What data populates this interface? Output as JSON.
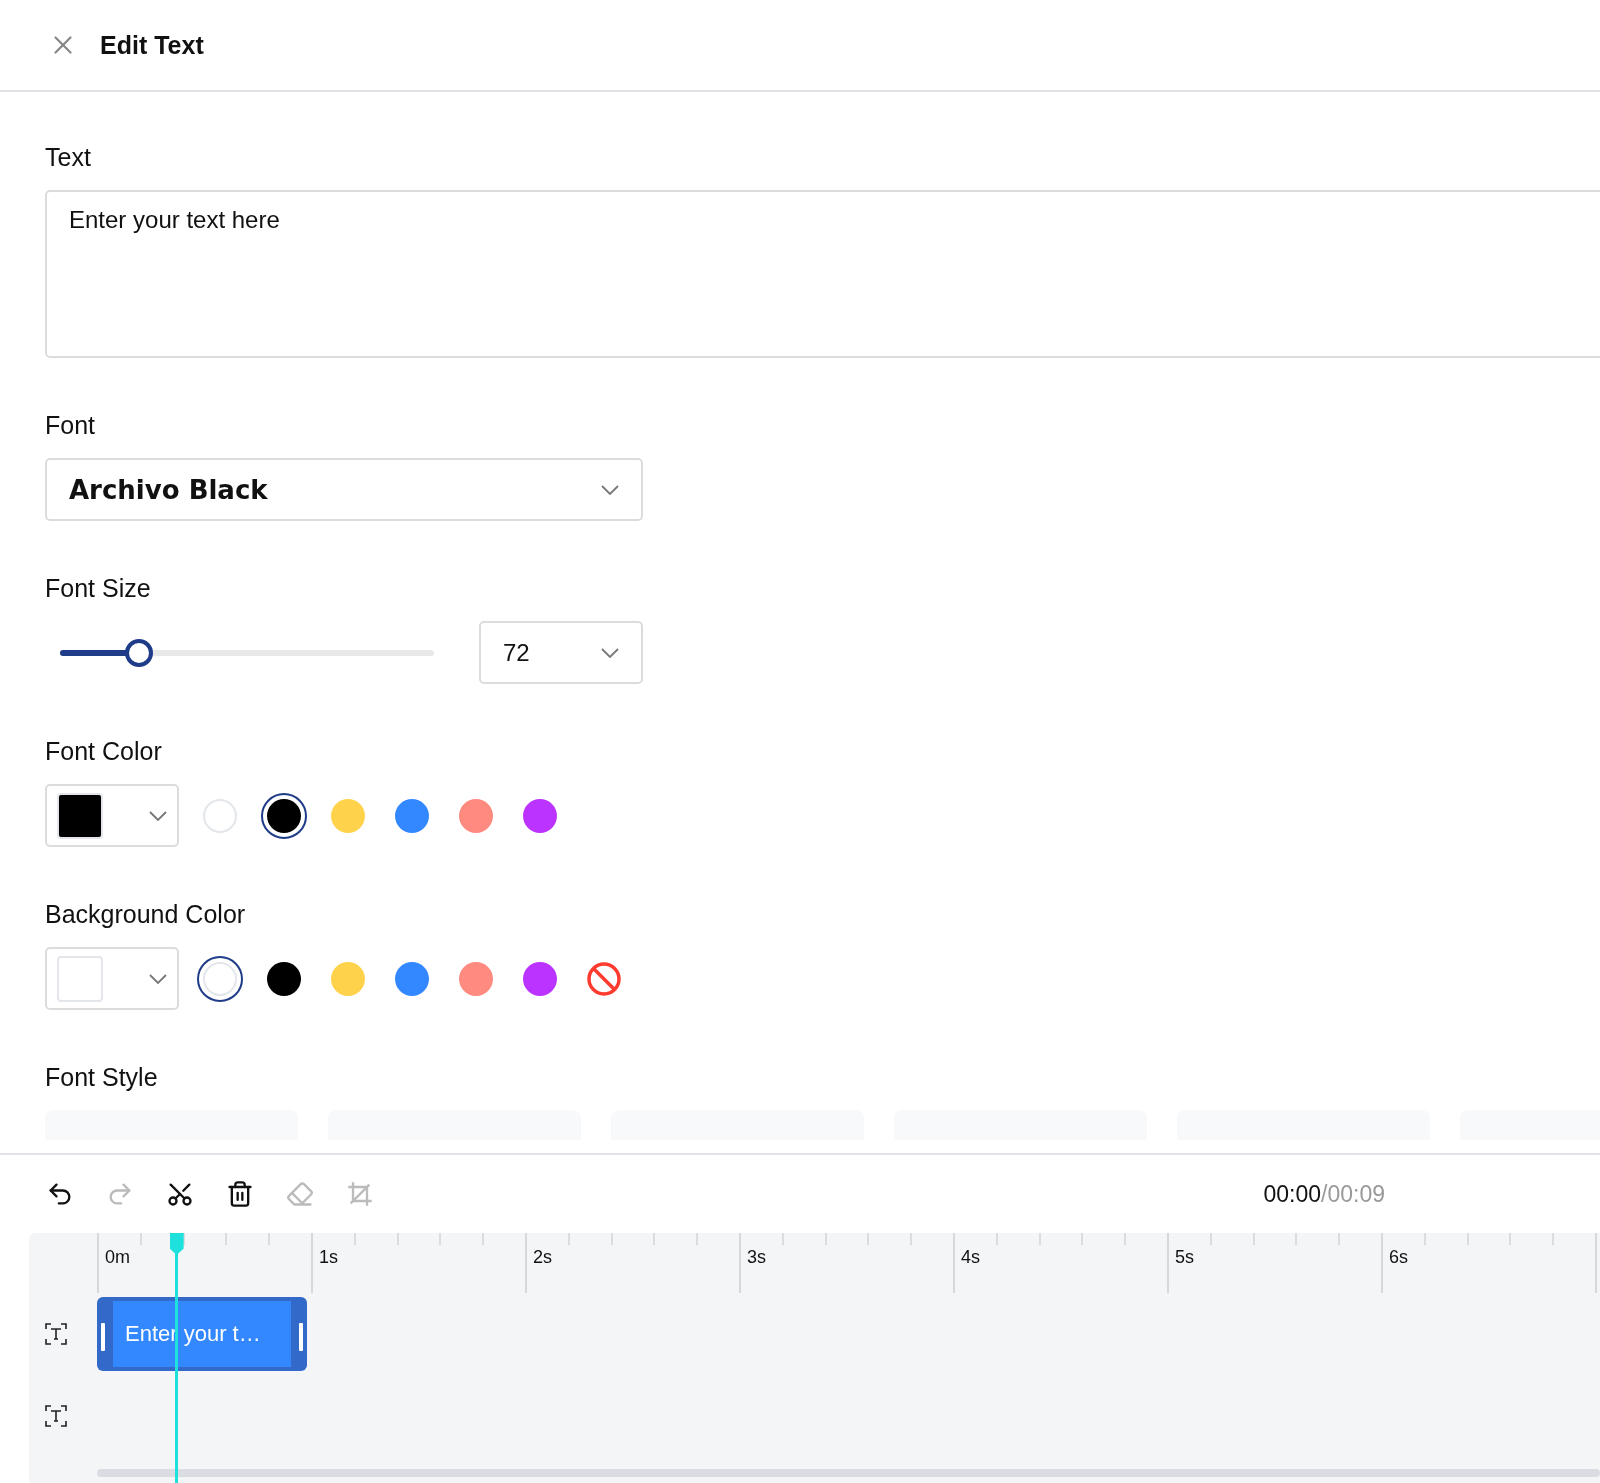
{
  "header": {
    "title": "Edit Text"
  },
  "text_field": {
    "label": "Text",
    "value": "Enter your text here"
  },
  "font": {
    "label": "Font",
    "value": "Archivo Black"
  },
  "font_size": {
    "label": "Font Size",
    "level": 0.21,
    "value": "72"
  },
  "font_color": {
    "label": "Font Color",
    "swatches": [
      {
        "kind": "color",
        "color": "#ffffff",
        "selected": false
      },
      {
        "kind": "color",
        "color": "#000000",
        "selected": true
      },
      {
        "kind": "color",
        "color": "#ffd24c",
        "selected": false
      },
      {
        "kind": "color",
        "color": "#3388ff",
        "selected": false
      },
      {
        "kind": "color",
        "color": "#ff8a80",
        "selected": false
      },
      {
        "kind": "color",
        "color": "#bb33ff",
        "selected": false
      }
    ]
  },
  "background_color": {
    "label": "Background Color",
    "swatches": [
      {
        "kind": "color",
        "color": "#ffffff",
        "selected": true
      },
      {
        "kind": "color",
        "color": "#000000",
        "selected": false
      },
      {
        "kind": "color",
        "color": "#ffd24c",
        "selected": false
      },
      {
        "kind": "color",
        "color": "#3388ff",
        "selected": false
      },
      {
        "kind": "color",
        "color": "#ff8a80",
        "selected": false
      },
      {
        "kind": "color",
        "color": "#bb33ff",
        "selected": false
      },
      {
        "kind": "none",
        "selected": false
      }
    ]
  },
  "font_style": {
    "label": "Font Style"
  },
  "toolbar": [
    {
      "kind": "undo",
      "disabled": false
    },
    {
      "kind": "redo",
      "disabled": true
    },
    {
      "kind": "cut",
      "disabled": false
    },
    {
      "kind": "delete",
      "disabled": false
    },
    {
      "kind": "erase",
      "disabled": true
    },
    {
      "kind": "crop",
      "disabled": true
    }
  ],
  "time": {
    "current": "00:00",
    "separator": "/",
    "total": "00:09"
  },
  "timeline": {
    "ruler": [
      "0m",
      "1s",
      "2s",
      "3s",
      "4s",
      "5s",
      "6s"
    ],
    "playhead": {
      "level": 0.053
    },
    "tracks": [
      {
        "kind": "text",
        "clip": "Enter your t…"
      },
      {
        "kind": "text"
      }
    ]
  }
}
